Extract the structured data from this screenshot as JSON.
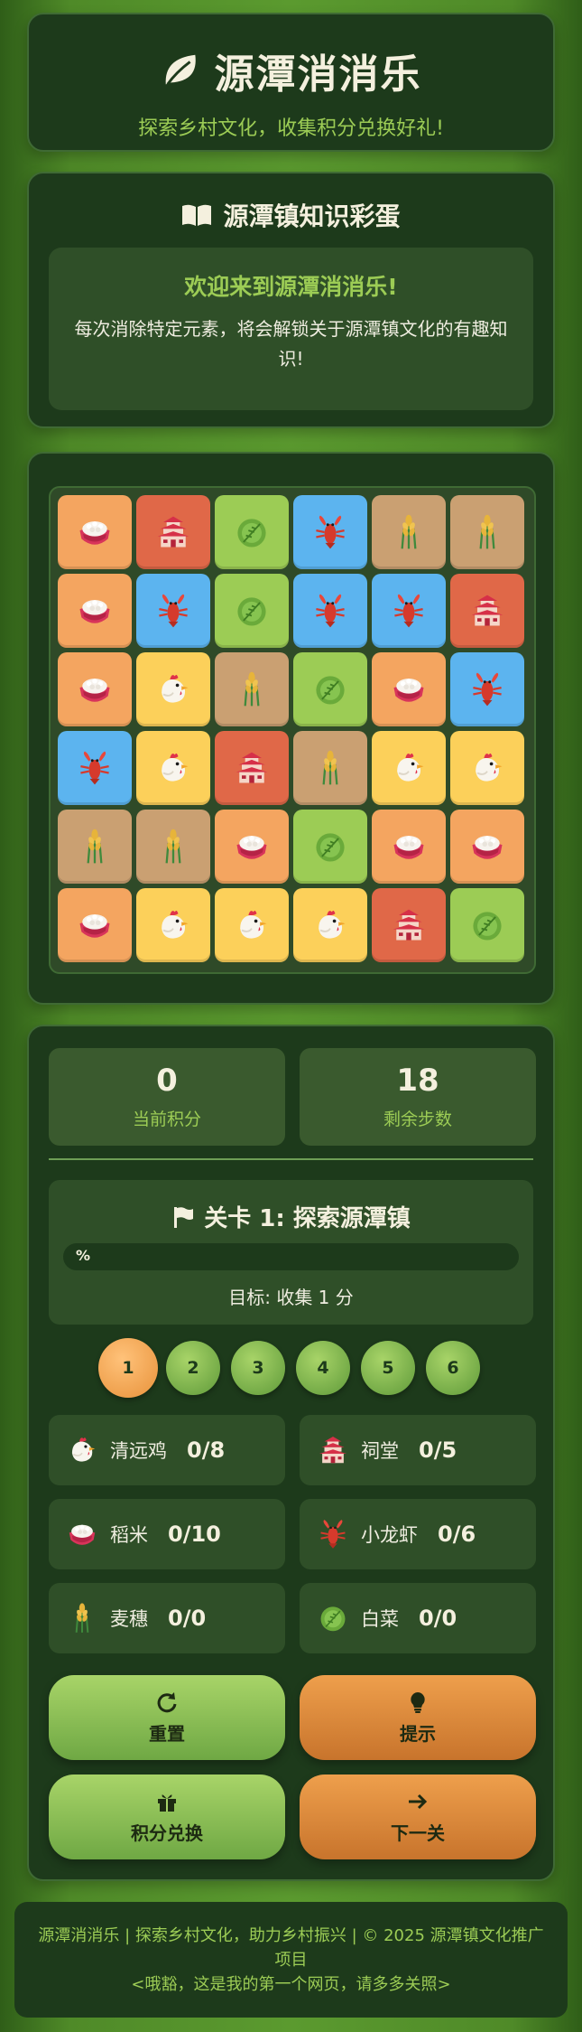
{
  "header": {
    "title": "源潭消消乐",
    "subtitle": "探索乡村文化，收集积分兑换好礼!"
  },
  "knowledge": {
    "title": "源潭镇知识彩蛋",
    "heading": "欢迎来到源潭消消乐!",
    "text": "每次消除特定元素，将会解锁关于源潭镇文化的有趣知识!"
  },
  "board": {
    "rows": [
      [
        "rice",
        "hall",
        "cabbage",
        "lobster",
        "wheat",
        "wheat"
      ],
      [
        "rice",
        "lobster",
        "cabbage",
        "lobster",
        "lobster",
        "hall"
      ],
      [
        "rice",
        "chicken",
        "wheat",
        "cabbage",
        "rice",
        "lobster"
      ],
      [
        "lobster",
        "chicken",
        "hall",
        "wheat",
        "chicken",
        "chicken"
      ],
      [
        "wheat",
        "wheat",
        "rice",
        "cabbage",
        "rice",
        "rice"
      ],
      [
        "rice",
        "chicken",
        "chicken",
        "chicken",
        "hall",
        "cabbage"
      ]
    ],
    "tile_icons": {
      "rice": "rice-bowl-icon",
      "hall": "ancestral-hall-icon",
      "cabbage": "cabbage-icon",
      "lobster": "lobster-icon",
      "wheat": "wheat-icon",
      "chicken": "chicken-icon"
    },
    "tile_colors": {
      "rice": "#f4a560",
      "hall": "#e06848",
      "cabbage": "#9ccc55",
      "lobster": "#5cb4ef",
      "wheat": "#caa072",
      "chicken": "#fcd05a"
    }
  },
  "stats": {
    "score": "0",
    "score_label": "当前积分",
    "moves": "18",
    "moves_label": "剩余步数"
  },
  "level": {
    "title": "关卡 1: 探索源潭镇",
    "progress_text": "%",
    "progress_fraction": 0,
    "goal": "目标: 收集 1 分"
  },
  "level_buttons": [
    "1",
    "2",
    "3",
    "4",
    "5",
    "6"
  ],
  "active_level": 1,
  "collect": [
    {
      "icon": "chicken-icon",
      "name": "清远鸡",
      "value": "0/8"
    },
    {
      "icon": "ancestral-hall-icon",
      "name": "祠堂",
      "value": "0/5"
    },
    {
      "icon": "rice-bowl-icon",
      "name": "稻米",
      "value": "0/10"
    },
    {
      "icon": "lobster-icon",
      "name": "小龙虾",
      "value": "0/6"
    },
    {
      "icon": "wheat-icon",
      "name": "麦穗",
      "value": "0/0"
    },
    {
      "icon": "cabbage-icon",
      "name": "白菜",
      "value": "0/0"
    }
  ],
  "actions": {
    "reset": "重置",
    "hint": "提示",
    "redeem": "积分兑换",
    "next": "下一关"
  },
  "footer": {
    "line1": "源潭消消乐 | 探索乡村文化，助力乡村振兴 | © 2025 源潭镇文化推广项目",
    "line2": "<哦豁，这是我的第一个网页，请多多关照>"
  },
  "colors": {
    "accent_green": "#9ccc55",
    "card_bg": "#1d3a1b",
    "orange": "#e8923a"
  }
}
